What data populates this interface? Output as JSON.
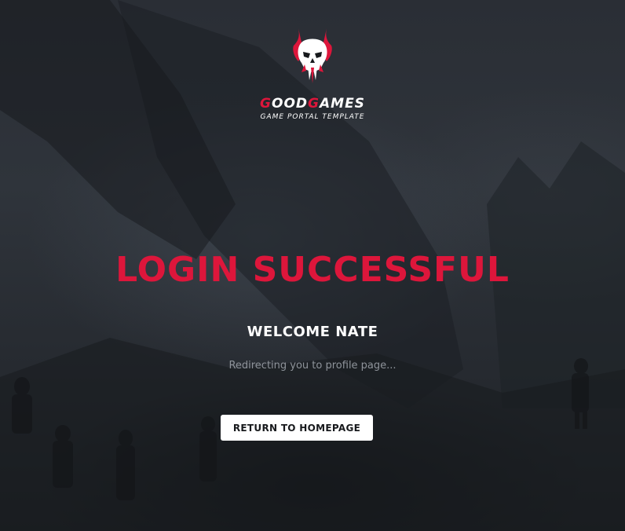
{
  "brand": {
    "name_parts": [
      "G",
      "OOD",
      "G",
      "AMES"
    ],
    "tagline": "GAME PORTAL TEMPLATE",
    "logo_icon": "demon-skull-icon"
  },
  "message": {
    "headline": "LOGIN SUCCESSFUL",
    "welcome": "WELCOME NATE",
    "redirect": "Redirecting you to profile page..."
  },
  "actions": {
    "return_home_label": "RETURN TO HOMEPAGE"
  },
  "colors": {
    "accent": "#dd163b",
    "text": "#ffffff",
    "muted": "#8e939a",
    "button_bg": "#ffffff",
    "background": "#2a2e35"
  }
}
